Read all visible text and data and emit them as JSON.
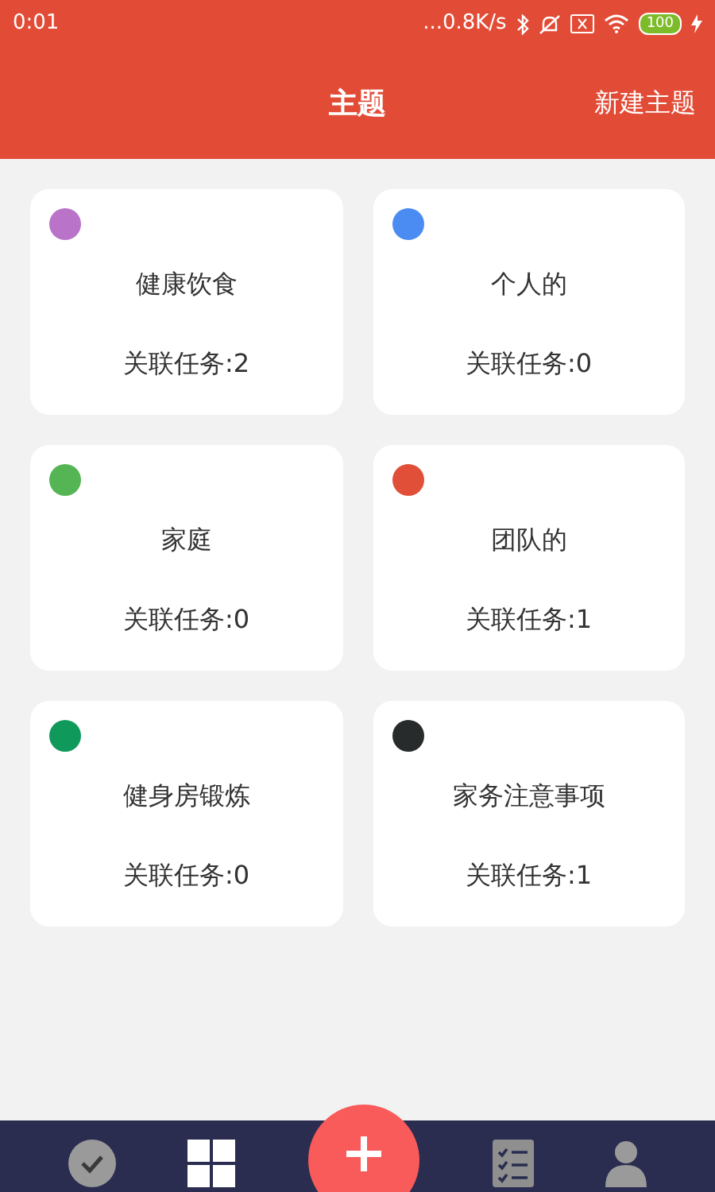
{
  "status_bar": {
    "time": "0:01",
    "speed": "...0.8K/s",
    "battery": "100"
  },
  "header": {
    "title": "主题",
    "action": "新建主题"
  },
  "topics": [
    {
      "name": "健康饮食",
      "count": "关联任务:2",
      "color": "#b974c9"
    },
    {
      "name": "个人的",
      "count": "关联任务:0",
      "color": "#4a8cf1"
    },
    {
      "name": "家庭",
      "count": "关联任务:0",
      "color": "#55b554"
    },
    {
      "name": "团队的",
      "count": "关联任务:1",
      "color": "#e14f38"
    },
    {
      "name": "健身房锻炼",
      "count": "关联任务:0",
      "color": "#0f9a5b"
    },
    {
      "name": "家务注意事项",
      "count": "关联任务:1",
      "color": "#272b2b"
    }
  ],
  "bottom_nav": [
    {
      "kind": "check"
    },
    {
      "kind": "grid"
    },
    {
      "kind": "add"
    },
    {
      "kind": "list"
    },
    {
      "kind": "person"
    }
  ]
}
